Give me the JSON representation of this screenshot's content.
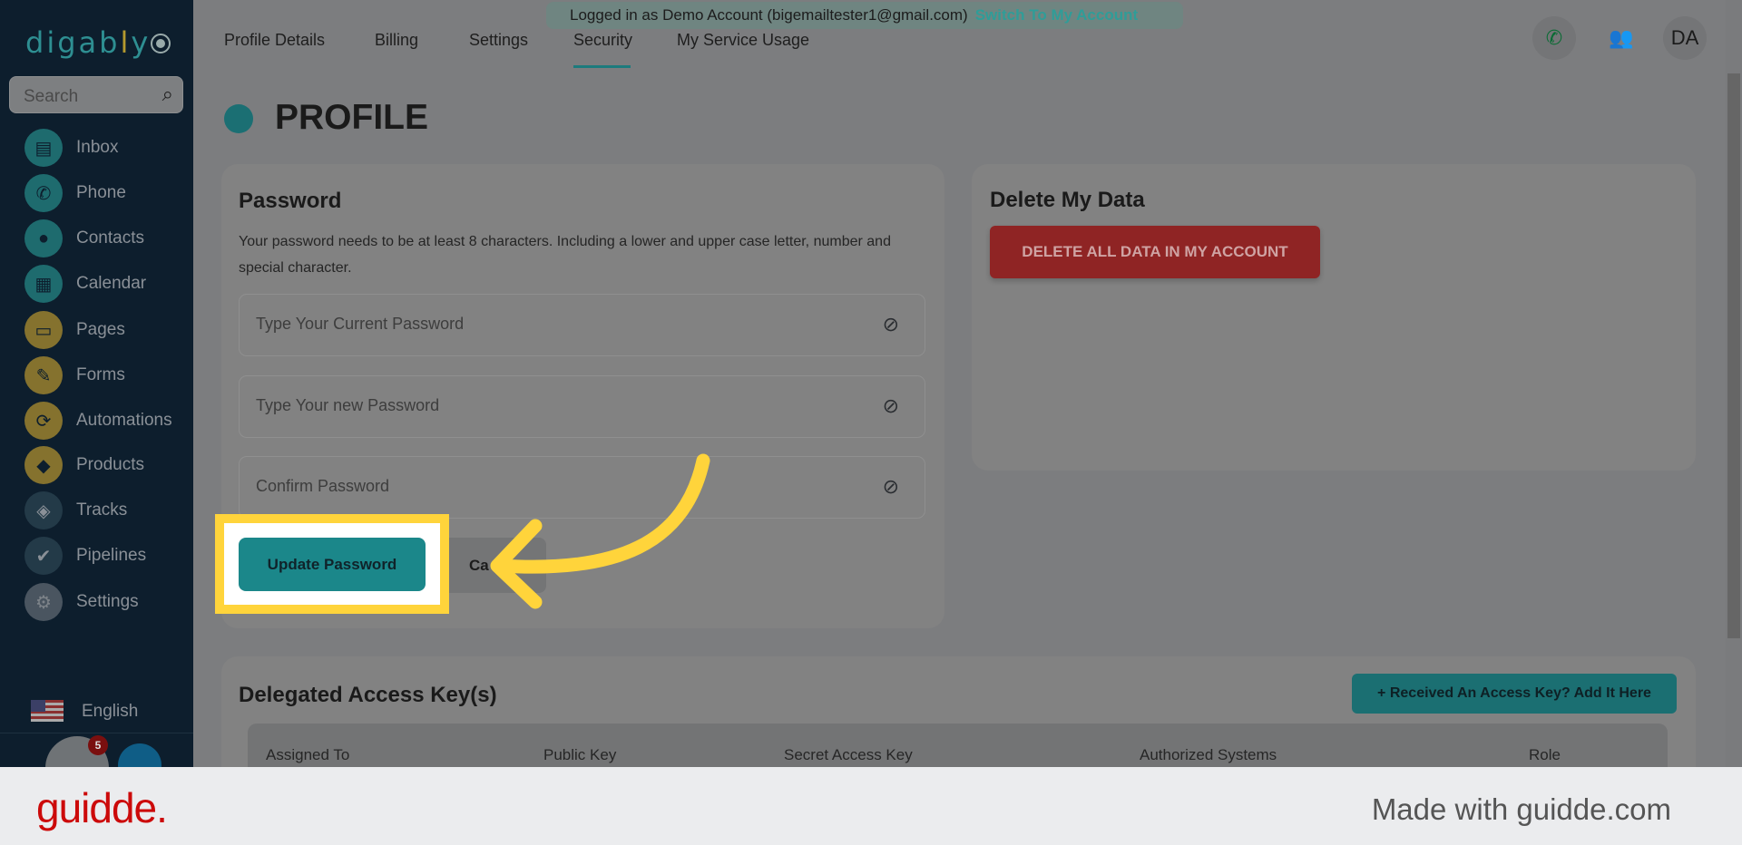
{
  "app": {
    "logo": "digably"
  },
  "sidebar": {
    "search_placeholder": "Search",
    "items": [
      {
        "label": "Inbox",
        "icon": "inbox-icon"
      },
      {
        "label": "Phone",
        "icon": "phone-icon"
      },
      {
        "label": "Contacts",
        "icon": "contacts-icon"
      },
      {
        "label": "Calendar",
        "icon": "calendar-icon"
      },
      {
        "label": "Pages",
        "icon": "pages-icon"
      },
      {
        "label": "Forms",
        "icon": "pencil-icon"
      },
      {
        "label": "Automations",
        "icon": "sync-icon"
      },
      {
        "label": "Products",
        "icon": "tag-icon"
      },
      {
        "label": "Tracks",
        "icon": "directions-icon"
      },
      {
        "label": "Pipelines",
        "icon": "check-circle-icon"
      },
      {
        "label": "Settings",
        "icon": "gear-icon"
      }
    ],
    "language": "English",
    "notification_count": "5"
  },
  "banner": {
    "text": "Logged in as Demo Account (bigemailtester1@gmail.com)",
    "switch_label": "Switch To My Account"
  },
  "tabs": [
    {
      "label": "Profile Details"
    },
    {
      "label": "Billing"
    },
    {
      "label": "Settings"
    },
    {
      "label": "Security",
      "active": true
    },
    {
      "label": "My Service Usage"
    }
  ],
  "header": {
    "avatar_initials": "DA"
  },
  "page": {
    "title": "PROFILE"
  },
  "password": {
    "title": "Password",
    "description": "Your password needs to be at least 8 characters. Including a lower and upper case letter, number and special character.",
    "current_placeholder": "Type Your Current Password",
    "new_placeholder": "Type Your new Password",
    "confirm_placeholder": "Confirm Password",
    "update_label": "Update Password",
    "cancel_label": "Ca"
  },
  "delete": {
    "title": "Delete My Data",
    "button_label": "DELETE ALL DATA IN MY ACCOUNT"
  },
  "delegated": {
    "title": "Delegated Access Key(s)",
    "add_label": "+ Received An Access Key? Add It Here",
    "columns": [
      "Assigned To",
      "Public Key",
      "Secret Access Key",
      "Authorized Systems",
      "Role"
    ]
  },
  "footer": {
    "brand": "guidde.",
    "made_with": "Made with guidde.com"
  },
  "colors": {
    "accent": "#1b878a",
    "highlight": "#ffd43b",
    "danger": "#8f2424"
  }
}
